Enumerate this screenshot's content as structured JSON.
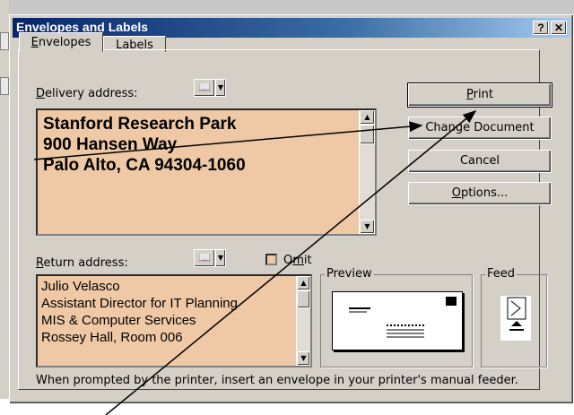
{
  "dialog": {
    "title": "Envelopes and Labels",
    "help_button": "?",
    "close_button": "✕",
    "tabs": [
      {
        "label": "Envelopes",
        "accel": "E",
        "rest": "nvelopes"
      },
      {
        "label": "Labels",
        "accel": "L",
        "rest": "abels"
      }
    ],
    "delivery": {
      "label_accel": "D",
      "label_rest": "elivery address:",
      "lines": [
        "Stanford Research Park",
        "900 Hansen Way",
        "Palo Alto, CA 94304-1060"
      ]
    },
    "return": {
      "label_accel": "R",
      "label_rest": "eturn address:",
      "lines": [
        "Julio Velasco",
        "Assistant Director for IT Planning",
        "MIS & Computer Services",
        "Rossey Hall, Room 006"
      ]
    },
    "omit": {
      "accel": "m",
      "pre": "O",
      "post": "it",
      "checked": false
    },
    "buttons": {
      "print_accel": "P",
      "print_rest": "rint",
      "change_document": "Change Document",
      "cancel": "Cancel",
      "options_accel": "O",
      "options_rest": "ptions..."
    },
    "preview_label": "Preview",
    "feed_label": "Feed",
    "footer_note": "When prompted by the printer, insert an envelope in your printer's manual feeder.",
    "address_book_icon": "address-book-icon"
  },
  "colors": {
    "address_bg": "#efc9a6",
    "title_start": "#0a246a"
  }
}
